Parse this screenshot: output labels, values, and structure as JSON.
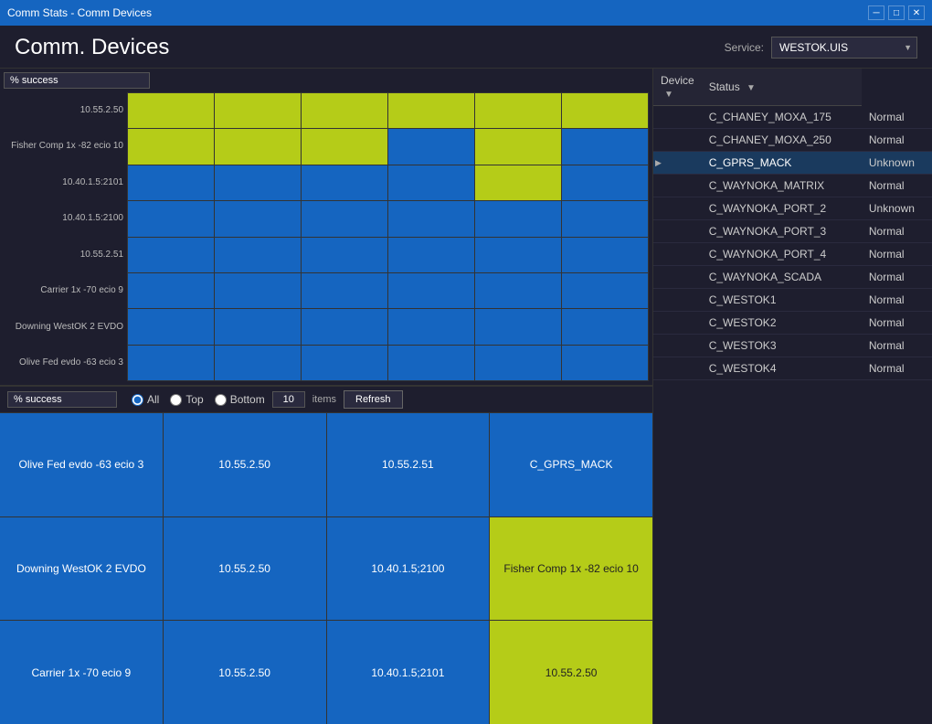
{
  "titlebar": {
    "title": "Comm Stats - Comm Devices",
    "controls": [
      "─",
      "□",
      "✕"
    ]
  },
  "header": {
    "title": "Comm. Devices",
    "service_label": "Service:",
    "service_value": "WESTOK.UIS",
    "service_options": [
      "WESTOK.UIS"
    ]
  },
  "chart_top": {
    "metric_label": "% success",
    "metric_options": [
      "% success"
    ],
    "rows": [
      "10.55.2.50",
      "Fisher Comp 1x -82 ecio 10",
      "10.40.1.5:2101",
      "10.40.1.5:2100",
      "10.55.2.51",
      "Carrier 1x -70 ecio 9",
      "Downing WestOK 2 EVDO",
      "Olive Fed  evdo -63 ecio 3"
    ]
  },
  "bottom_controls": {
    "metric_label": "% success",
    "radio_options": [
      "All",
      "Top",
      "Bottom"
    ],
    "radio_selected": "All",
    "items_value": "10",
    "items_label": "items",
    "refresh_label": "Refresh"
  },
  "tiles": [
    {
      "label": "Olive Fed  evdo -63 ecio 3",
      "color": "blue"
    },
    {
      "label": "10.55.2.50",
      "color": "blue"
    },
    {
      "label": "10.55.2.51",
      "color": "blue"
    },
    {
      "label": "C_GPRS_MACK",
      "color": "blue"
    },
    {
      "label": "Downing WestOK 2 EVDO",
      "color": "blue"
    },
    {
      "label": "10.55.2.50",
      "color": "blue"
    },
    {
      "label": "10.40.1.5;2100",
      "color": "blue"
    },
    {
      "label": "Fisher Comp 1x -82 ecio 10",
      "color": "green"
    },
    {
      "label": "Carrier 1x -70 ecio 9",
      "color": "blue"
    },
    {
      "label": "10.55.2.50",
      "color": "blue"
    },
    {
      "label": "10.40.1.5;2101",
      "color": "blue"
    },
    {
      "label": "10.55.2.50",
      "color": "green"
    }
  ],
  "device_table": {
    "columns": [
      {
        "label": "Device",
        "has_filter": true
      },
      {
        "label": "Status",
        "has_filter": true
      }
    ],
    "rows": [
      {
        "device": "C_CHANEY_MOXA_175",
        "status": "Normal",
        "selected": false,
        "arrow": false
      },
      {
        "device": "C_CHANEY_MOXA_250",
        "status": "Normal",
        "selected": false,
        "arrow": false
      },
      {
        "device": "C_GPRS_MACK",
        "status": "Unknown",
        "selected": true,
        "arrow": true
      },
      {
        "device": "C_WAYNOKA_MATRIX",
        "status": "Normal",
        "selected": false,
        "arrow": false
      },
      {
        "device": "C_WAYNOKA_PORT_2",
        "status": "Unknown",
        "selected": false,
        "arrow": false
      },
      {
        "device": "C_WAYNOKA_PORT_3",
        "status": "Normal",
        "selected": false,
        "arrow": false
      },
      {
        "device": "C_WAYNOKA_PORT_4",
        "status": "Normal",
        "selected": false,
        "arrow": false
      },
      {
        "device": "C_WAYNOKA_SCADA",
        "status": "Normal",
        "selected": false,
        "arrow": false
      },
      {
        "device": "C_WESTOK1",
        "status": "Normal",
        "selected": false,
        "arrow": false
      },
      {
        "device": "C_WESTOK2",
        "status": "Normal",
        "selected": false,
        "arrow": false
      },
      {
        "device": "C_WESTOK3",
        "status": "Normal",
        "selected": false,
        "arrow": false
      },
      {
        "device": "C_WESTOK4",
        "status": "Normal",
        "selected": false,
        "arrow": false
      }
    ]
  },
  "colors": {
    "accent_blue": "#1565c0",
    "accent_green": "#b5cc18",
    "titlebar": "#1565c0",
    "bg": "#1e1e2e"
  }
}
